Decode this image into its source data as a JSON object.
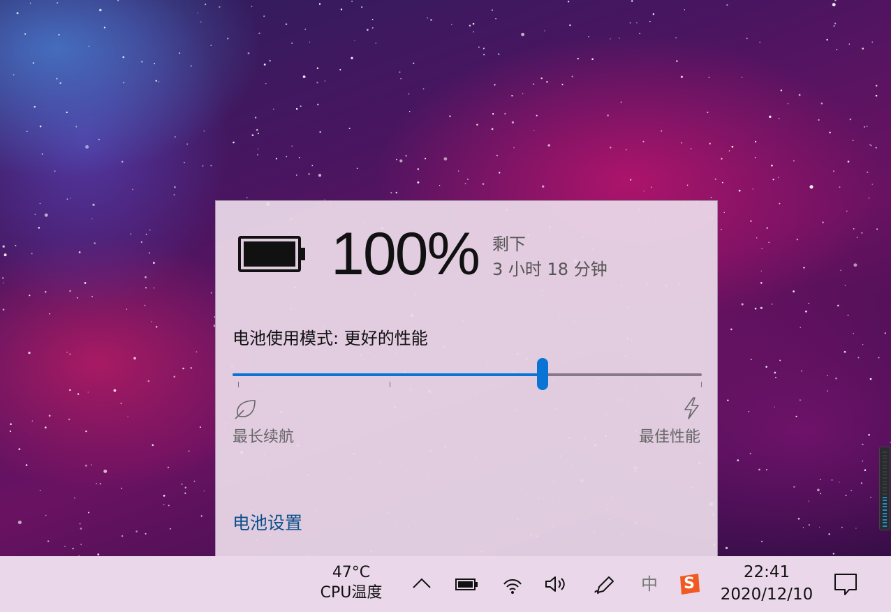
{
  "battery": {
    "percent_text": "100%",
    "remaining_label": "剩下",
    "remaining_time": "3 小时 18 分钟",
    "mode_label": "电池使用模式: 更好的性能",
    "slider_level": 0.66,
    "left_label": "最长续航",
    "right_label": "最佳性能",
    "settings_link": "电池设置",
    "icons": {
      "left": "leaf-icon",
      "right": "lightning-bolt-icon"
    },
    "accent_color": "#0a74d4"
  },
  "taskbar": {
    "cpu_temp": "47°C",
    "cpu_label": "CPU温度",
    "tray": [
      "chevron-up-icon",
      "battery-icon",
      "wifi-icon",
      "speaker-icon",
      "pen-icon",
      "input-method-icon",
      "sogou-icon"
    ],
    "ime_char": "中",
    "sogou_char": "S",
    "time": "22:41",
    "date": "2020/12/10",
    "notification_icon": "action-center-icon"
  }
}
